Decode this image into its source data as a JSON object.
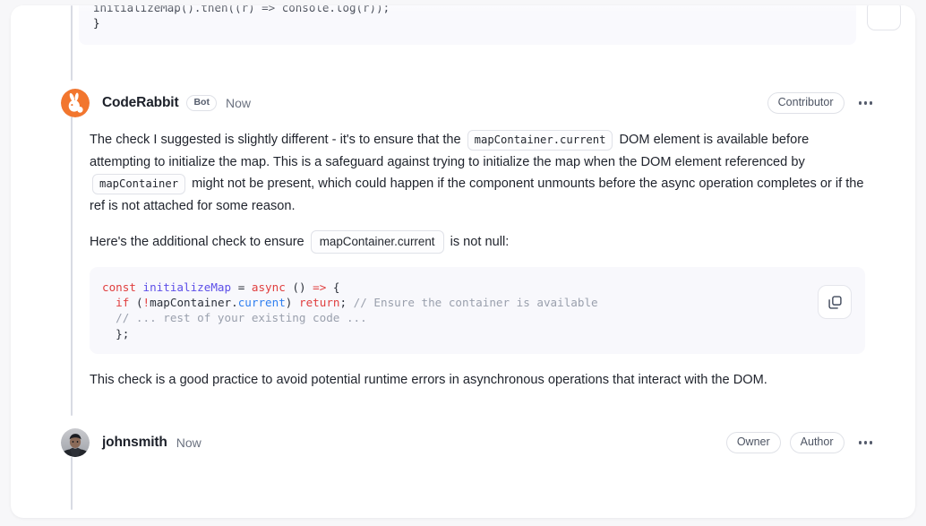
{
  "top_code_snippet": {
    "line1": "initializeMap().then((r) => console.log(r));",
    "line2": "}"
  },
  "comments": [
    {
      "author": "CodeRabbit",
      "bot_badge": "Bot",
      "timestamp": "Now",
      "avatar_icon": "rabbit-avatar",
      "roles": [
        "Contributor"
      ],
      "menu_icon": "kebab-menu-icon",
      "paragraph1": {
        "part1": "The check I suggested is slightly different - it's to ensure that the",
        "code1": "mapContainer.current",
        "part2": "DOM element is available before attempting to initialize the map. This is a safeguard against trying to initialize the map when the DOM element referenced by",
        "code2": "mapContainer",
        "part3": "might not be present, which could happen if the component unmounts before the async operation completes or if the ref is not attached for some reason."
      },
      "paragraph2": {
        "part1": "Here's the additional check to ensure",
        "code1": "mapContainer.current",
        "part2": "is not null:"
      },
      "code_block": {
        "language": "javascript",
        "copy_button_icon": "copy-icon",
        "lines": [
          "const initializeMap = async () => {",
          "  if (!mapContainer.current) return; // Ensure the container is available",
          "  // ... rest of your existing code ...",
          "  };"
        ]
      },
      "paragraph3": "This check is a good practice to avoid potential runtime errors in asynchronous operations that interact with the DOM."
    },
    {
      "author": "johnsmith",
      "timestamp": "Now",
      "avatar_icon": "person-photo-avatar",
      "roles": [
        "Owner",
        "Author"
      ],
      "menu_icon": "kebab-menu-icon"
    }
  ],
  "colors": {
    "accent_orange": "#f2762e",
    "code_bg": "#f8f8fc",
    "keyword_red": "#e03e3e",
    "function_purple": "#5d4fe8",
    "property_blue": "#2f7ff0",
    "comment_gray": "#9aa0ad",
    "rail_gray": "#d8dbe3"
  }
}
